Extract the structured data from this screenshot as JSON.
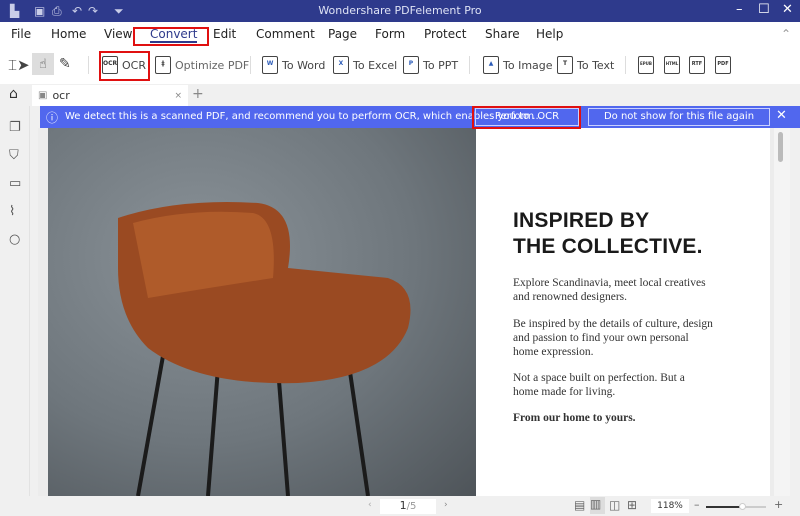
{
  "app": {
    "title": "Wondershare PDFelement Pro"
  },
  "menu": {
    "items": [
      "File",
      "Home",
      "View",
      "Convert",
      "Edit",
      "Comment",
      "Page",
      "Form",
      "Protect",
      "Share",
      "Help"
    ],
    "active": "Convert"
  },
  "toolbar": {
    "ocr": "OCR",
    "optimize": "Optimize PDF",
    "to_word": "To Word",
    "to_excel": "To Excel",
    "to_ppt": "To PPT",
    "to_image": "To Image",
    "to_text": "To Text",
    "format_icons": [
      "EPUB",
      "HTML",
      "RTF",
      "PDF"
    ]
  },
  "tab": {
    "name": "ocr"
  },
  "banner": {
    "message": "We detect this is a scanned PDF, and recommend you to perform OCR, which enables you to ...",
    "perform": "Perform OCR",
    "dismiss": "Do not show for this file again"
  },
  "document": {
    "heading_1": "INSPIRED BY",
    "heading_2": "THE COLLECTIVE.",
    "para1": "Explore Scandinavia, meet local creatives and renowned designers.",
    "para2": "Be inspired by the details of culture, design and passion to find your own personal home expression.",
    "para3": "Not a space built on perfection. But a home made for living.",
    "para4": "From our home to yours."
  },
  "status": {
    "page_current": "1",
    "page_total": "/5",
    "zoom": "118%",
    "zoom_level_percent": 118
  },
  "colors": {
    "titlebar": "#2e3a8c",
    "banner": "#5167ee",
    "highlight": "#e01010",
    "chair": "#9a4a22"
  }
}
